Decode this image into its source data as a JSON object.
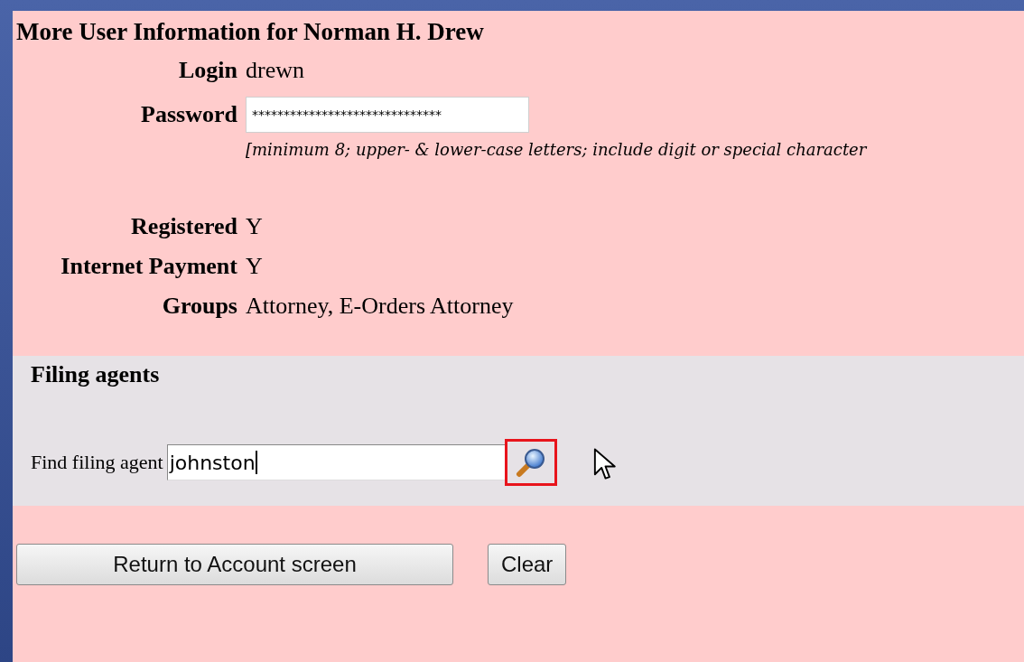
{
  "title": "More User Information for Norman H. Drew",
  "fields": [
    {
      "kind": "text",
      "label": "Login",
      "value": "drewn"
    },
    {
      "kind": "password",
      "label": "Password",
      "value": "******************************",
      "hint": "[minimum 8; upper- & lower-case letters; include digit or special character"
    },
    {
      "kind": "text",
      "label": "Registered",
      "value": "Y"
    },
    {
      "kind": "text",
      "label": "Internet Payment",
      "value": "Y"
    },
    {
      "kind": "text",
      "label": "Groups",
      "value": "Attorney, E-Orders Attorney"
    }
  ],
  "filing_agents": {
    "heading": "Filing agents",
    "find_label": "Find filing agent",
    "value": "johnston",
    "search_highlighted": true
  },
  "buttons": [
    "Return to Account screen",
    "Clear"
  ]
}
